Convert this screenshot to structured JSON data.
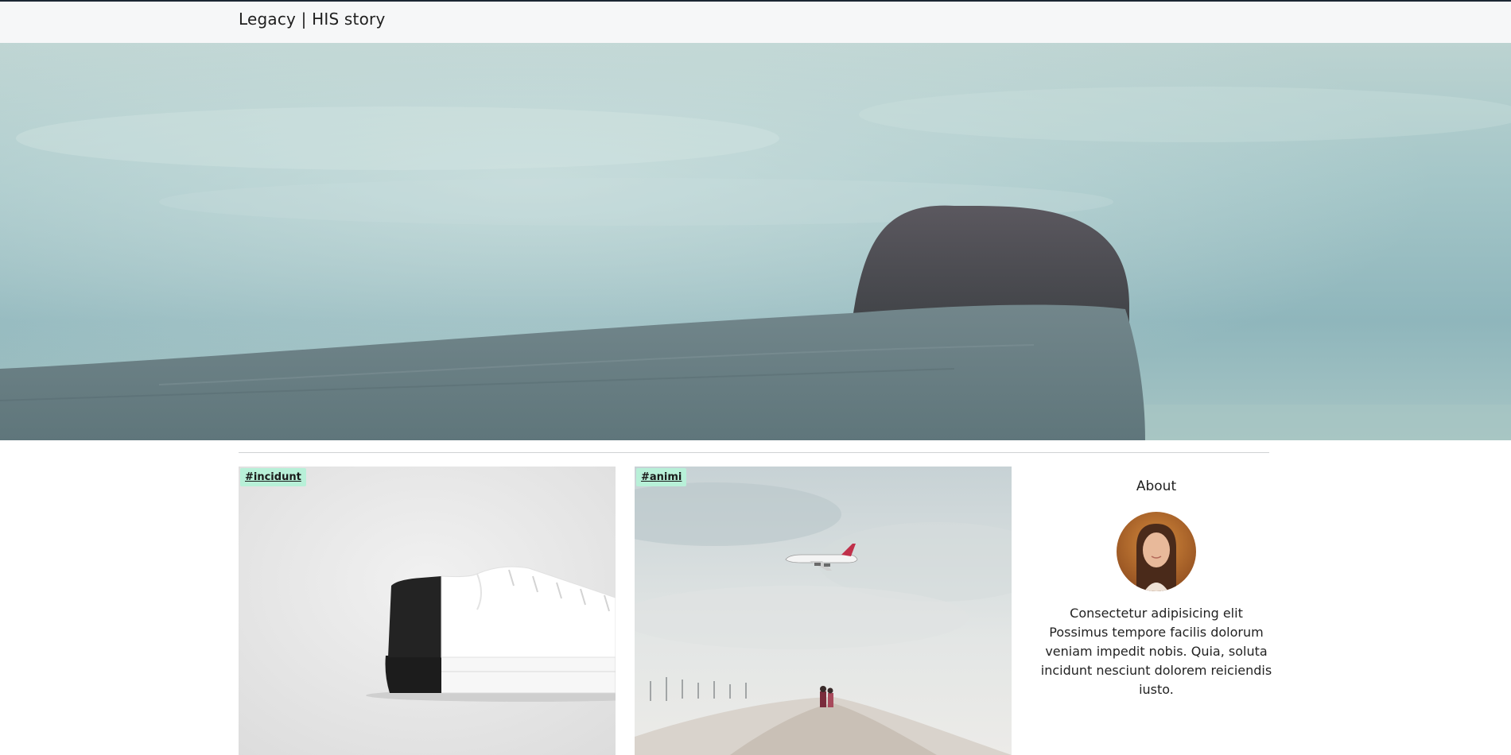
{
  "navbar": {
    "brand": "Legacy | HIS story"
  },
  "hero": {
    "image_desc": "hero-photo"
  },
  "posts": [
    {
      "tag": "#incidunt",
      "image": "white-sneaker-photo"
    },
    {
      "tag": "#animi",
      "image": "airplane-beach-photo"
    }
  ],
  "about": {
    "title": "About",
    "text": "Consectetur adipisicing elit Possimus tempore facilis dolorum veniam impedit nobis. Quia, soluta incidunt nesciunt dolorem reiciendis iusto."
  },
  "colors": {
    "navbar_bg": "#f6f7f8",
    "tag_bg": "#b8f0d8",
    "hero_sky": "#9fc3c7",
    "topline": "#1c2733"
  }
}
